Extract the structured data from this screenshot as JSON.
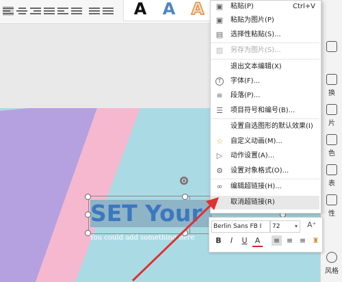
{
  "ribbon": {
    "wordart_samples": [
      {
        "glyph": "A",
        "style": "black"
      },
      {
        "glyph": "A",
        "style": "blue"
      },
      {
        "glyph": "A",
        "style": "orange-outline"
      }
    ]
  },
  "context_menu": {
    "items": [
      {
        "label": "粘贴(P)",
        "shortcut": "Ctrl+V",
        "icon": "paste-icon",
        "disabled": false
      },
      {
        "label": "粘贴为图片(P)",
        "icon": "paste-as-image-icon",
        "disabled": false
      },
      {
        "label": "选择性粘贴(S)...",
        "icon": "paste-special-icon",
        "disabled": false
      },
      {
        "label": "另存为图片(S)...",
        "icon": "save-as-image-icon",
        "disabled": true
      },
      {
        "label": "退出文本编辑(X)",
        "icon": "",
        "disabled": false
      },
      {
        "label": "字体(F)...",
        "icon": "font-icon",
        "disabled": false
      },
      {
        "label": "段落(P)...",
        "icon": "paragraph-icon",
        "disabled": false
      },
      {
        "label": "项目符号和编号(B)...",
        "icon": "bullets-icon",
        "disabled": false
      },
      {
        "label": "设置自选图形的默认效果(I)",
        "icon": "",
        "disabled": false
      },
      {
        "label": "自定义动画(M)...",
        "icon": "custom-animation-icon",
        "disabled": false
      },
      {
        "label": "动作设置(A)...",
        "icon": "action-settings-icon",
        "disabled": false
      },
      {
        "label": "设置对象格式(O)...",
        "icon": "format-object-icon",
        "disabled": false
      },
      {
        "label": "编辑超链接(H)...",
        "icon": "hyperlink-icon",
        "disabled": false
      },
      {
        "label": "取消超链接(R)",
        "icon": "",
        "disabled": false,
        "highlighted": true
      }
    ]
  },
  "slide": {
    "title": "SET Your Title",
    "subtitle": "You could add something here",
    "colors": {
      "background": "#aadbe5",
      "stripe_purple": "#b6a1e0",
      "stripe_pink": "#f6b8cf",
      "title_text": "#3b78bf"
    }
  },
  "mini_toolbar": {
    "font_name": "Berlin Sans FB I",
    "font_size": "72",
    "buttons": [
      "B",
      "I",
      "U",
      "A"
    ]
  },
  "right_panel": {
    "items": [
      "换",
      "片",
      "色",
      "表",
      "性"
    ],
    "bottom_label": "风格"
  }
}
